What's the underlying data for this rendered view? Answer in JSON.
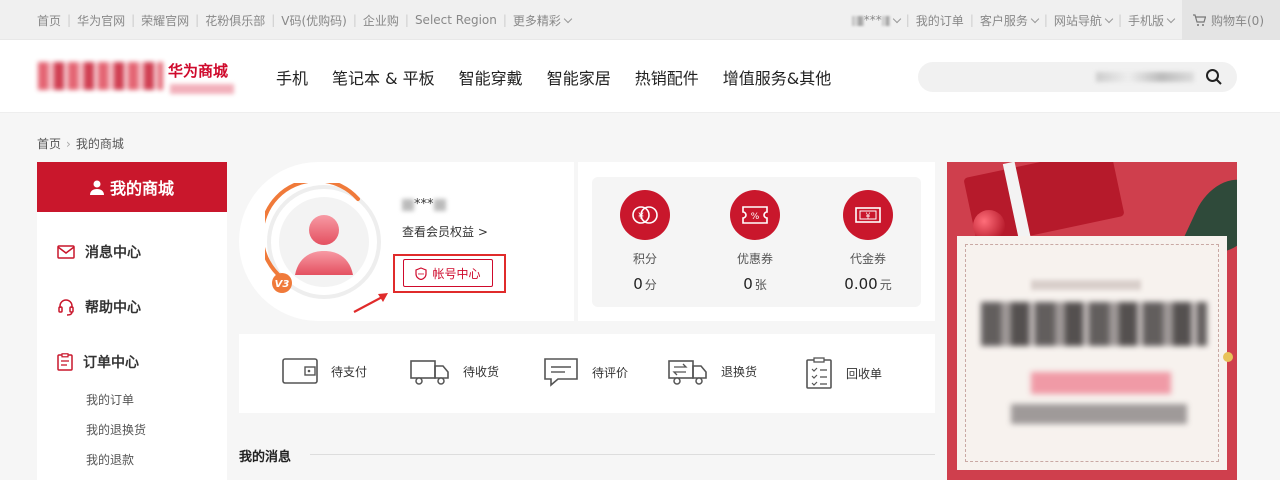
{
  "topbar": {
    "links": [
      "首页",
      "华为官网",
      "荣耀官网",
      "花粉俱乐部",
      "V码(优购码)",
      "企业购",
      "Select Region",
      "更多精彩"
    ],
    "user_suffix": "***",
    "right_links": [
      "我的订单",
      "客户服务",
      "网站导航",
      "手机版"
    ],
    "cart_label": "购物车(0)"
  },
  "header": {
    "logo_text": "华为商城",
    "nav": [
      "手机",
      "笔记本 & 平板",
      "智能穿戴",
      "智能家居",
      "热销配件",
      "增值服务&其他"
    ]
  },
  "breadcrumb": {
    "home": "首页",
    "current": "我的商城"
  },
  "sidebar": {
    "title": "我的商城",
    "groups": [
      {
        "label": "消息中心",
        "icon": "mail-icon"
      },
      {
        "label": "帮助中心",
        "icon": "headset-icon"
      },
      {
        "label": "订单中心",
        "icon": "clipboard-icon"
      }
    ],
    "order_sub": [
      "我的订单",
      "我的退换货",
      "我的退款"
    ]
  },
  "profile": {
    "username_masked": "***",
    "level_badge": "V3",
    "member_benefits": "查看会员权益 >",
    "account_center": "帐号中心"
  },
  "assets": [
    {
      "label": "积分",
      "value": "0",
      "unit": "分",
      "icon": "points-icon"
    },
    {
      "label": "优惠券",
      "value": "0",
      "unit": "张",
      "icon": "coupon-icon"
    },
    {
      "label": "代金券",
      "value": "0.00",
      "unit": "元",
      "icon": "voucher-icon"
    }
  ],
  "orders": [
    {
      "label": "待支付",
      "icon": "wallet-icon"
    },
    {
      "label": "待收货",
      "icon": "truck-icon"
    },
    {
      "label": "待评价",
      "icon": "comment-icon"
    },
    {
      "label": "退换货",
      "icon": "return-truck-icon"
    },
    {
      "label": "回收单",
      "icon": "recycle-list-icon"
    }
  ],
  "messages_title": "我的消息",
  "colors": {
    "brand_red": "#cf0a2c",
    "highlight_red": "#e02b2b",
    "avatar_ring": "#f07a3a"
  }
}
